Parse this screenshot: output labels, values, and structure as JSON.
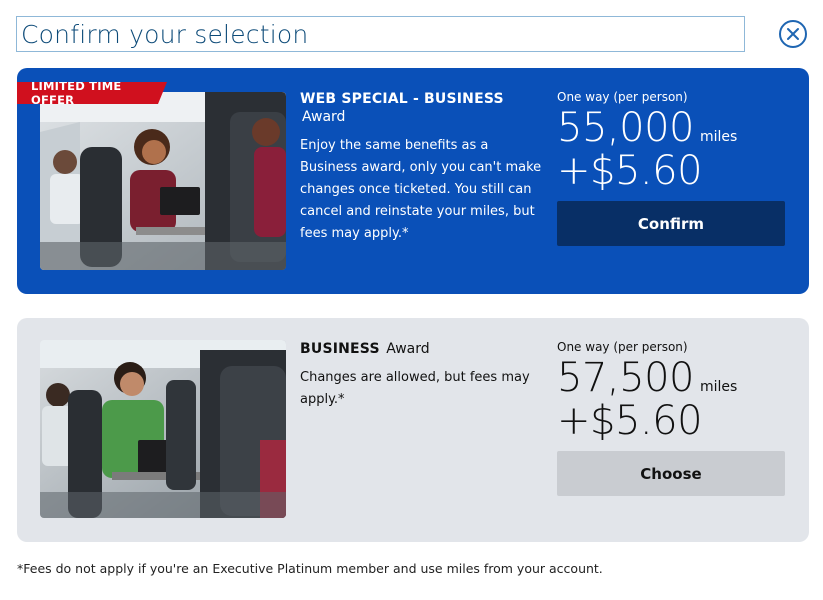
{
  "header": {
    "title": "Confirm your selection",
    "close_icon": "close-circle-icon"
  },
  "special_offer": {
    "ribbon": "LIMITED TIME OFFER",
    "name_strong": "WEB SPECIAL - BUSINESS",
    "name_light": "Award",
    "description": "Enjoy the same benefits as a Business award, only you can't make changes once ticketed. You still can cancel and reinstate your miles, but fees may apply.*",
    "per_person": "One way (per person)",
    "miles": "55,000",
    "miles_unit": "miles",
    "fee": "+$5.60",
    "button_label": "Confirm"
  },
  "standard_offer": {
    "name_strong": "BUSINESS",
    "name_light": "Award",
    "description": "Changes are allowed, but fees may apply.*",
    "per_person": "One way (per person)",
    "miles": "57,500",
    "miles_unit": "miles",
    "fee": "+$5.60",
    "button_label": "Choose"
  },
  "footnote": "*Fees do not apply if you're an Executive Platinum member and use miles from your account.",
  "colors": {
    "special_card_bg": "#0a50b8",
    "special_button_bg": "#082f66",
    "standard_card_bg": "#e2e5ea",
    "standard_button_bg": "#c9ccd1",
    "ribbon_bg": "#d0101e",
    "title_color": "#0c4a78",
    "close_icon_color": "#1f66b2"
  }
}
